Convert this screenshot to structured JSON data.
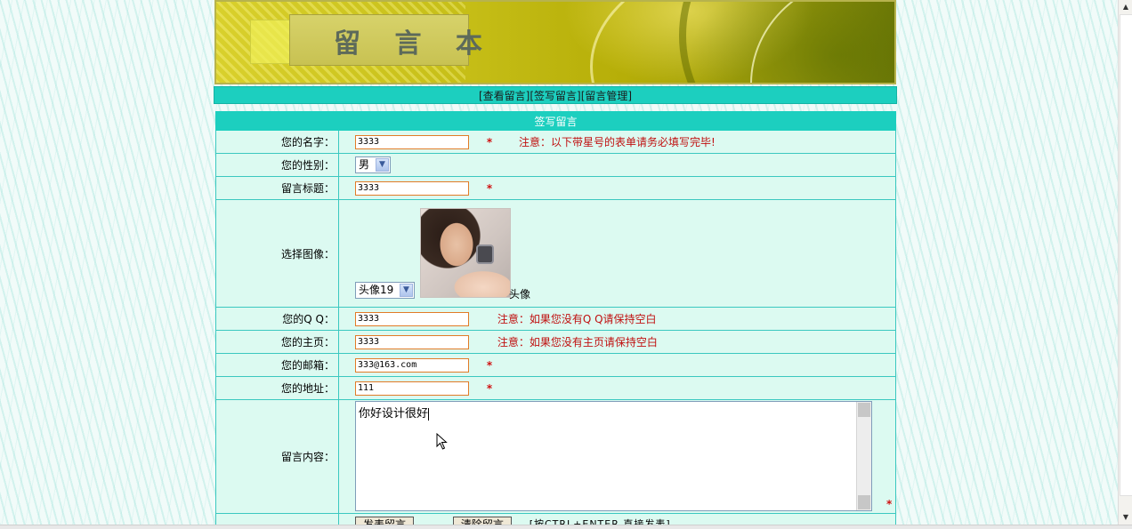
{
  "header": {
    "title": "留 言 本"
  },
  "nav": {
    "view": "[查看留言]",
    "write": "[签写留言]",
    "manage": "[留言管理]"
  },
  "form": {
    "heading": "签写留言",
    "name": {
      "label": "您的名字：",
      "value": "3333",
      "required_mark": "*",
      "note": "注意：以下带星号的表单请务必填写完毕!"
    },
    "gender": {
      "label": "您的性别：",
      "selected": "男"
    },
    "title": {
      "label": "留言标题：",
      "value": "3333",
      "required_mark": "*"
    },
    "avatar": {
      "label": "选择图像：",
      "selected": "头像19",
      "caption": "头像"
    },
    "qq": {
      "label": "您的Q Q：",
      "value": "3333",
      "note": "注意：如果您没有Q Q请保持空白"
    },
    "homepage": {
      "label": "您的主页：",
      "value": "3333",
      "note": "注意：如果您没有主页请保持空白"
    },
    "email": {
      "label": "您的邮箱：",
      "value": "333@163.com",
      "required_mark": "*"
    },
    "address": {
      "label": "您的地址：",
      "value": "111",
      "required_mark": "*"
    },
    "content": {
      "label": "留言内容：",
      "value": "你好设计很好",
      "required_mark": "*"
    },
    "submit_label": "发表留言",
    "clear_label": "清除留言",
    "hint": "[按CTRL+ENTER 直接发表]"
  },
  "icons": {
    "dropdown": "chevron-down-icon",
    "cursor": "mouse-pointer-icon"
  },
  "colors": {
    "accent": "#1ccfbf",
    "required": "#d01010",
    "input_border": "#e27b27",
    "row_bg": "#dcfaf1"
  }
}
